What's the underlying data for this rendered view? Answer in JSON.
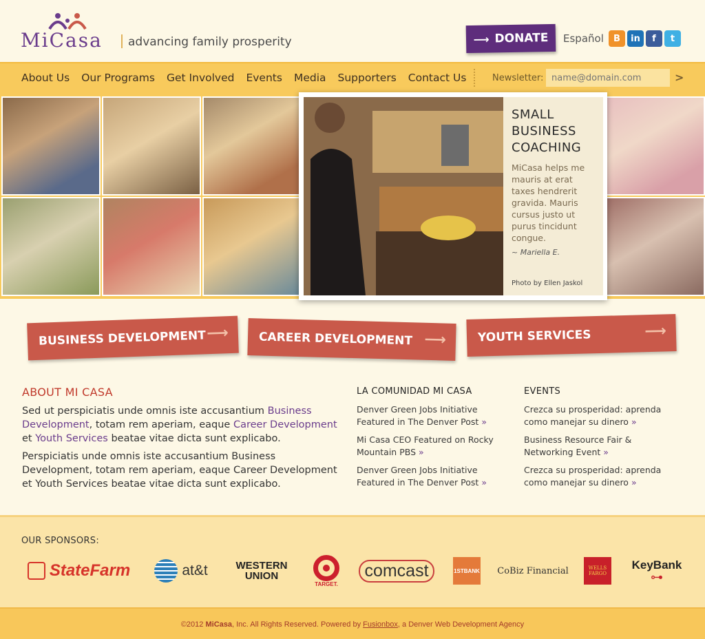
{
  "header": {
    "logo_text": "MiCasa",
    "tagline": "advancing family prosperity",
    "donate_label": "DONATE",
    "language_link": "Español",
    "social": [
      "blogger-icon",
      "linkedin-icon",
      "facebook-icon",
      "twitter-icon"
    ]
  },
  "nav": {
    "items": [
      "About Us",
      "Our Programs",
      "Get Involved",
      "Events",
      "Media",
      "Supporters",
      "Contact Us"
    ],
    "newsletter_label": "Newsletter:",
    "newsletter_placeholder": "name@domain.com",
    "newsletter_submit": ">"
  },
  "feature": {
    "title": "SMALL BUSINESS COACHING",
    "body": "MiCasa helps me mauris at erat taxes hendrerit gravida. Mauris cursus justo ut purus tincidunt congue.",
    "author": "~ Mariella E.",
    "credit": "Photo by Ellen Jaskol"
  },
  "programs": [
    "BUSINESS DEVELOPMENT",
    "CAREER DEVELOPMENT",
    "YOUTH SERVICES"
  ],
  "about": {
    "title": "ABOUT MI CASA",
    "p1_pre": "Sed ut perspiciatis unde omnis iste accusantium ",
    "p1_link1": "Business Development",
    "p1_mid1": ", totam rem aperiam, eaque ",
    "p1_link2": "Career Development",
    "p1_mid2": " et ",
    "p1_link3": "Youth Services",
    "p1_post": " beatae vitae dicta sunt explicabo.",
    "p2": "Perspiciatis unde omnis iste  accusantium Business Development, totam rem aperiam, eaque Career Development et Youth Services beatae vitae dicta sunt explicabo."
  },
  "community": {
    "title": "LA COMUNIDAD MI CASA",
    "items": [
      "Denver Green Jobs Initiative Featured in The Denver Post",
      "Mi Casa CEO Featured on Rocky Mountain PBS",
      "Denver Green Jobs Initiative Featured in The Denver Post"
    ],
    "more": "»"
  },
  "events": {
    "title": "EVENTS",
    "items": [
      "Crezca su prosperidad: aprenda como manejar su dinero",
      "Business Resource Fair & Networking Event",
      "Crezca su prosperidad: aprenda como manejar su dinero"
    ],
    "more": "»"
  },
  "sponsors": {
    "label": "OUR SPONSORS:",
    "logos": [
      "StateFarm",
      "at&t",
      "WESTERN UNION",
      "TARGET.",
      "comcast",
      "1STBANK",
      "CoBiz Financial",
      "WELLS FARGO",
      "KeyBank"
    ]
  },
  "footer": {
    "copyright": "©2012 ",
    "brand": "MiCasa",
    "rights": ", Inc. All Rights Reserved.  Powered by ",
    "agency": "Fusionbox",
    "agency_desc": ", a Denver Web Development Agency"
  },
  "colors": {
    "accent_purple": "#5e2d7c",
    "nav_yellow": "#f8ca5c",
    "banner_red": "#c9594a",
    "heading_red": "#c0392b"
  }
}
